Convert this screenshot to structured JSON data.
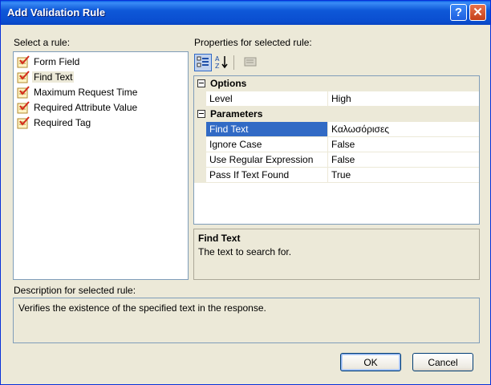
{
  "window": {
    "title": "Add Validation Rule"
  },
  "titlebar_buttons": {
    "help": "?",
    "close": "✕"
  },
  "rules": {
    "label": "Select a rule:",
    "items": [
      {
        "label": "Form Field"
      },
      {
        "label": "Find Text"
      },
      {
        "label": "Maximum Request Time"
      },
      {
        "label": "Required Attribute Value"
      },
      {
        "label": "Required Tag"
      }
    ],
    "selected": "Find Text"
  },
  "properties": {
    "label": "Properties for selected rule:",
    "toolbar": {
      "icons": [
        "categorized-icon",
        "alphabetical-icon",
        "property-pages-icon"
      ],
      "sort_glyph": "A\nZ"
    },
    "categories": [
      {
        "name": "Options",
        "rows": [
          {
            "name": "Level",
            "value": "High"
          }
        ]
      },
      {
        "name": "Parameters",
        "rows": [
          {
            "name": "Find Text",
            "value": "Καλωσόρισες"
          },
          {
            "name": "Ignore Case",
            "value": "False"
          },
          {
            "name": "Use Regular Expression",
            "value": "False"
          },
          {
            "name": "Pass If Text Found",
            "value": "True"
          }
        ]
      }
    ],
    "selected_property": "Find Text",
    "help": {
      "title": "Find Text",
      "text": "The text to search for."
    }
  },
  "description": {
    "label": "Description for selected rule:",
    "text": "Verifies the existence of the specified text in the response."
  },
  "buttons": {
    "ok": "OK",
    "cancel": "Cancel"
  },
  "colors": {
    "title_bar": "#0a4ed0",
    "selection": "#316ac5",
    "dialog_bg": "#ece9d8"
  }
}
